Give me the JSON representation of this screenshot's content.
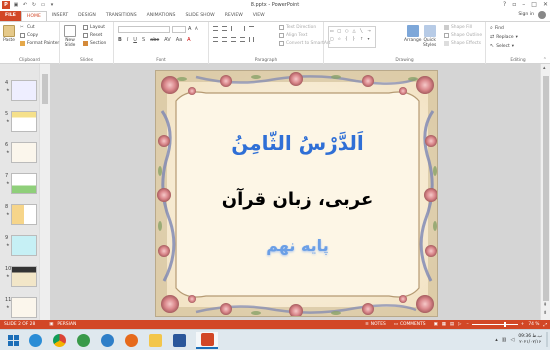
{
  "app": {
    "file_name": "8.pptx - PowerPoint",
    "sign_in": "Sign in"
  },
  "tabs": [
    "FILE",
    "HOME",
    "INSERT",
    "DESIGN",
    "TRANSITIONS",
    "ANIMATIONS",
    "SLIDE SHOW",
    "REVIEW",
    "VIEW"
  ],
  "ribbon": {
    "clipboard": {
      "label": "Clipboard",
      "paste": "Paste",
      "cut": "Cut",
      "copy": "Copy",
      "format_painter": "Format Painter"
    },
    "slides": {
      "label": "Slides",
      "new_slide": "New\nSlide",
      "layout": "Layout",
      "reset": "Reset",
      "section": "Section"
    },
    "font": {
      "label": "Font"
    },
    "paragraph": {
      "label": "Paragraph",
      "text_direction": "Text Direction",
      "align_text": "Align Text",
      "convert_smartart": "Convert to SmartArt"
    },
    "drawing": {
      "label": "Drawing",
      "arrange": "Arrange",
      "quick_styles": "Quick\nStyles",
      "shape_fill": "Shape Fill",
      "shape_outline": "Shape Outline",
      "shape_effects": "Shape Effects"
    },
    "editing": {
      "label": "Editing",
      "find": "Find",
      "replace": "Replace",
      "select": "Select"
    }
  },
  "thumbnails": [
    {
      "num": "4",
      "style": "list"
    },
    {
      "num": "5",
      "style": "yellow"
    },
    {
      "num": "6",
      "style": "plain"
    },
    {
      "num": "7",
      "style": "green"
    },
    {
      "num": "8",
      "style": "mixed"
    },
    {
      "num": "9",
      "style": "cyan"
    },
    {
      "num": "10",
      "style": "dark"
    },
    {
      "num": "11",
      "style": "plain"
    }
  ],
  "slide": {
    "title_line1": "اَلدَّرْسُ الثّامِنُ",
    "title_line2": "عربی، زبان قرآن",
    "title_line3": "پایه نهم"
  },
  "status": {
    "slide_indicator": "SLIDE 2 OF 28",
    "language": "PERSIAN",
    "notes": "NOTES",
    "comments": "COMMENTS",
    "zoom": "74 %"
  },
  "taskbar": {
    "time": "09:36 ب.ظ",
    "date": "۲۰۲۱/۰۲/۱۶",
    "apps": [
      "start",
      "edge",
      "chrome",
      "media",
      "globe",
      "firefox",
      "folder",
      "word",
      "powerpoint"
    ]
  },
  "colors": {
    "accent": "#d24726",
    "title_blue": "#2f6fd6",
    "subtitle_blue": "#6b9fe6",
    "text_black": "#000000"
  }
}
